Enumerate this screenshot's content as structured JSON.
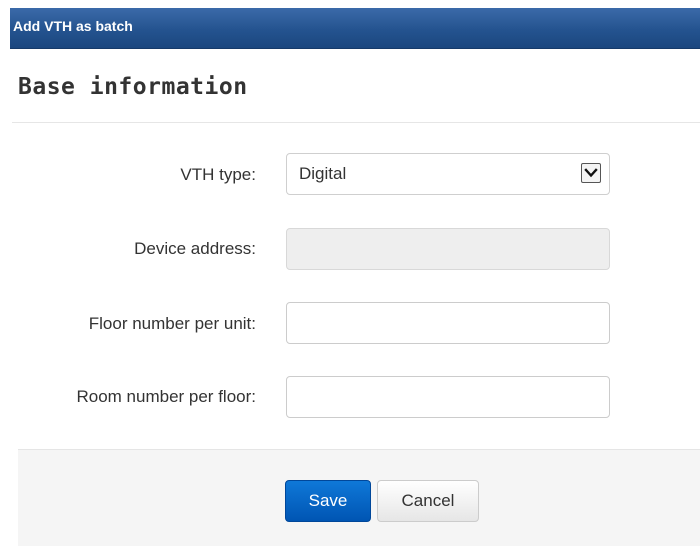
{
  "dialog": {
    "title": "Add VTH as batch"
  },
  "section": {
    "title": "Base information"
  },
  "form": {
    "vth_type": {
      "label": "VTH type:",
      "value": "Digital"
    },
    "device_address": {
      "label": "Device address:",
      "value": "",
      "disabled": true
    },
    "floor_number": {
      "label": "Floor number per unit:",
      "value": ""
    },
    "room_number": {
      "label": "Room number per floor:",
      "value": ""
    }
  },
  "footer": {
    "save_label": "Save",
    "cancel_label": "Cancel"
  },
  "colors": {
    "titlebar": "#24538f",
    "primary_button": "#0a6bcc",
    "footer_bg": "#f5f5f5",
    "disabled_input": "#eeeeee"
  },
  "icons": {
    "select_arrow": "chevron-down-icon"
  }
}
